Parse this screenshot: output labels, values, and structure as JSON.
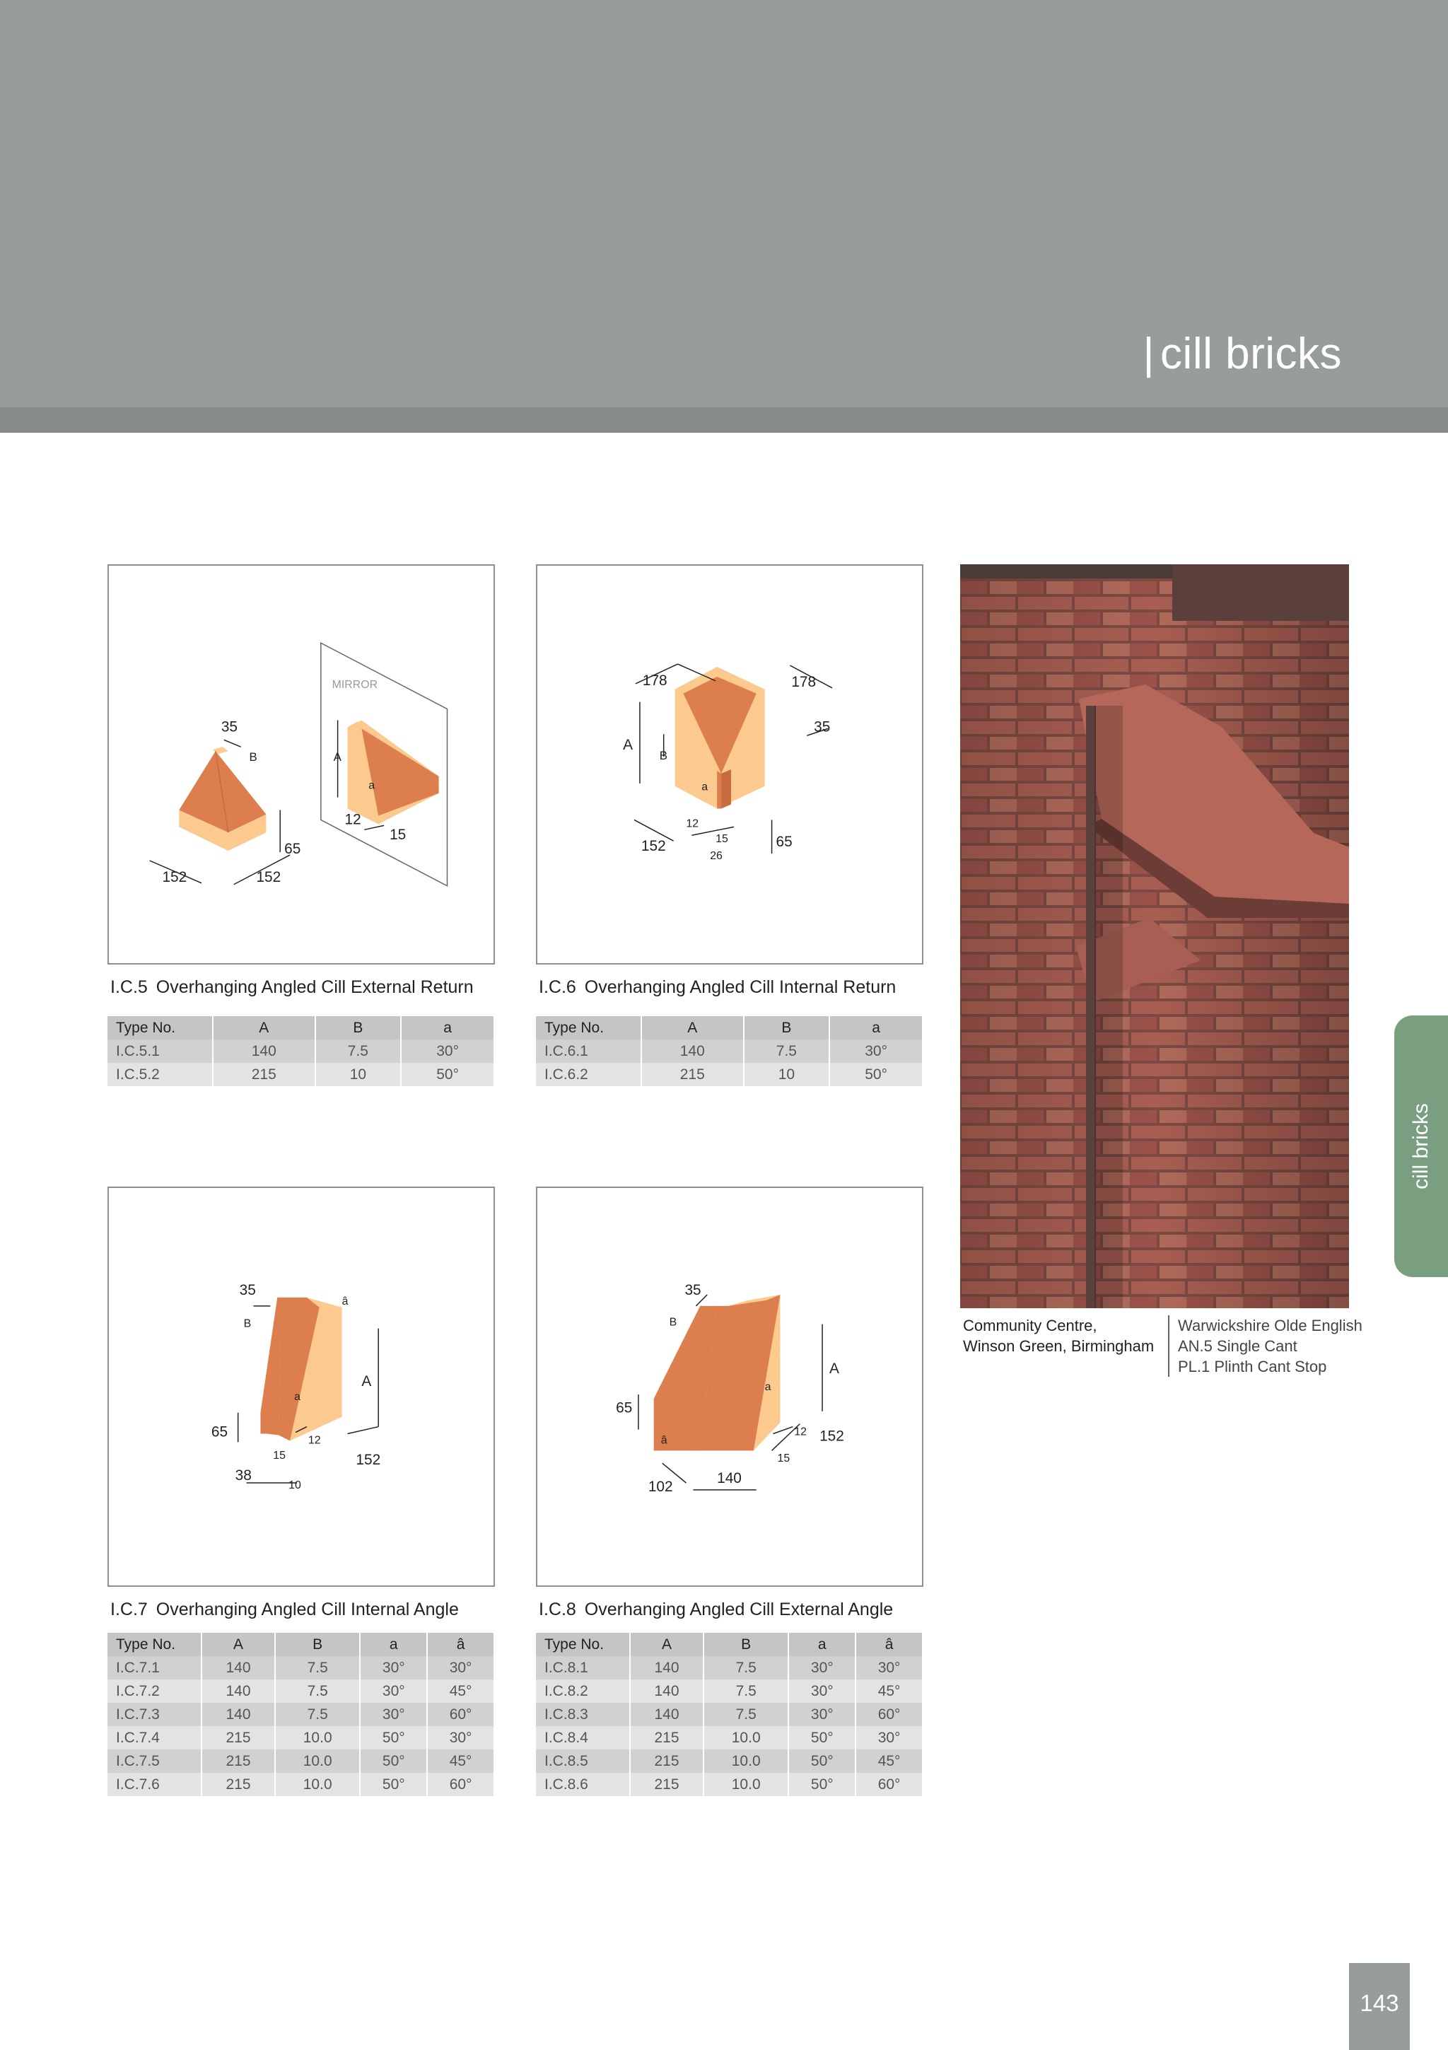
{
  "header": {
    "title_bar": "|",
    "title": "cill bricks"
  },
  "side_tab": {
    "label": "cill bricks"
  },
  "page_number": "143",
  "colors": {
    "brick_dark": "#dd7e4e",
    "brick_light": "#fcca8e",
    "header_grey": "#979d99",
    "tab_green": "#7a9e80"
  },
  "diagrams": {
    "ic5": {
      "mirror": "MIRROR",
      "d35": "35",
      "dB": "B",
      "d152a": "152",
      "d152b": "152",
      "d65": "65",
      "dA": "A",
      "da": "a",
      "d12": "12",
      "d15": "15"
    },
    "ic6": {
      "d178a": "178",
      "d178b": "178",
      "d35": "35",
      "dA": "A",
      "dB": "B",
      "da": "a",
      "d12": "12",
      "d15": "15",
      "d26": "26",
      "d152": "152",
      "d65": "65"
    },
    "ic7": {
      "d35": "35",
      "dB": "B",
      "dahat": "â",
      "dA": "A",
      "da": "a",
      "d65": "65",
      "d12": "12",
      "d15": "15",
      "d38": "38",
      "d10": "10",
      "d152": "152"
    },
    "ic8": {
      "d35": "35",
      "dB": "B",
      "dA": "A",
      "da": "a",
      "d65": "65",
      "dahat": "â",
      "d12": "12",
      "d15": "15",
      "d152": "152",
      "d102": "102",
      "d140": "140"
    }
  },
  "products": [
    {
      "code": "I.C.5",
      "name": "Overhanging Angled Cill External Return",
      "columns": [
        "Type No.",
        "A",
        "B",
        "a"
      ],
      "rows": [
        [
          "I.C.5.1",
          "140",
          "7.5",
          "30°"
        ],
        [
          "I.C.5.2",
          "215",
          "10",
          "50°"
        ]
      ]
    },
    {
      "code": "I.C.6",
      "name": "Overhanging Angled Cill Internal Return",
      "columns": [
        "Type No.",
        "A",
        "B",
        "a"
      ],
      "rows": [
        [
          "I.C.6.1",
          "140",
          "7.5",
          "30°"
        ],
        [
          "I.C.6.2",
          "215",
          "10",
          "50°"
        ]
      ]
    },
    {
      "code": "I.C.7",
      "name": "Overhanging Angled Cill Internal Angle",
      "columns": [
        "Type No.",
        "A",
        "B",
        "a",
        "â"
      ],
      "rows": [
        [
          "I.C.7.1",
          "140",
          "7.5",
          "30°",
          "30°"
        ],
        [
          "I.C.7.2",
          "140",
          "7.5",
          "30°",
          "45°"
        ],
        [
          "I.C.7.3",
          "140",
          "7.5",
          "30°",
          "60°"
        ],
        [
          "I.C.7.4",
          "215",
          "10.0",
          "50°",
          "30°"
        ],
        [
          "I.C.7.5",
          "215",
          "10.0",
          "50°",
          "45°"
        ],
        [
          "I.C.7.6",
          "215",
          "10.0",
          "50°",
          "60°"
        ]
      ]
    },
    {
      "code": "I.C.8",
      "name": "Overhanging Angled Cill External Angle",
      "columns": [
        "Type No.",
        "A",
        "B",
        "a",
        "â"
      ],
      "rows": [
        [
          "I.C.8.1",
          "140",
          "7.5",
          "30°",
          "30°"
        ],
        [
          "I.C.8.2",
          "140",
          "7.5",
          "30°",
          "45°"
        ],
        [
          "I.C.8.3",
          "140",
          "7.5",
          "30°",
          "60°"
        ],
        [
          "I.C.8.4",
          "215",
          "10.0",
          "50°",
          "30°"
        ],
        [
          "I.C.8.5",
          "215",
          "10.0",
          "50°",
          "45°"
        ],
        [
          "I.C.8.6",
          "215",
          "10.0",
          "50°",
          "60°"
        ]
      ]
    }
  ],
  "photo": {
    "caption_left": [
      "Community Centre,",
      "Winson Green, Birmingham"
    ],
    "caption_right": [
      "Warwickshire Olde English",
      "AN.5 Single Cant",
      "PL.1 Plinth Cant Stop"
    ]
  }
}
